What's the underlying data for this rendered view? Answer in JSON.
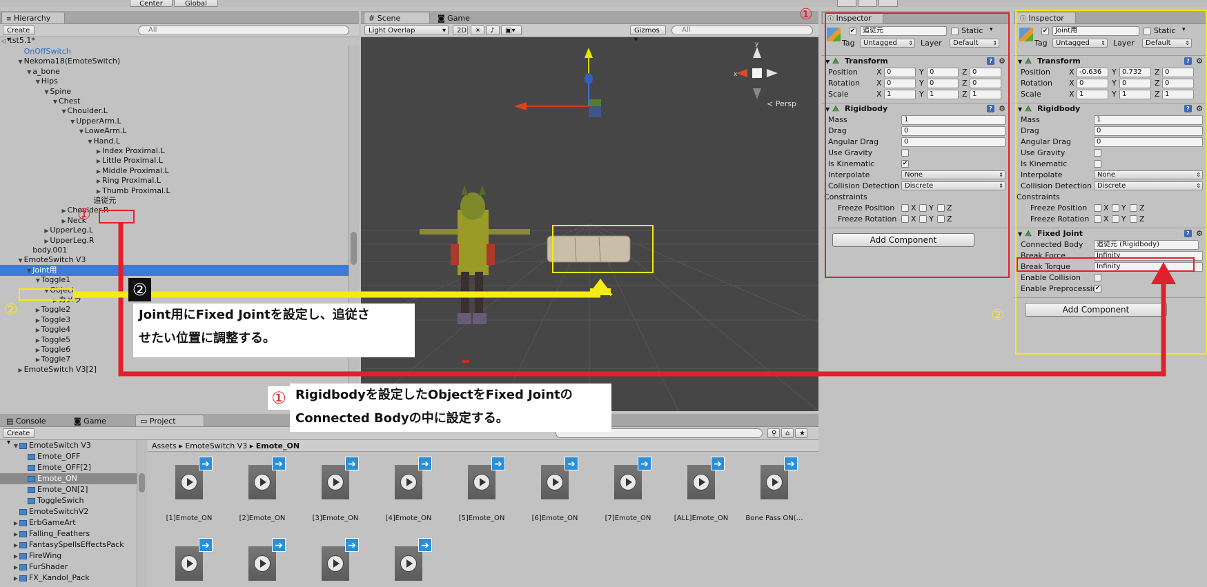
{
  "top_toolbar": {
    "center_label": "Center",
    "global_label": "Global"
  },
  "hierarchy": {
    "tab": "Hierarchy",
    "create_label": "Create",
    "search_placeholder": "All",
    "scene_name": "tst5.1*",
    "items": [
      {
        "label": "OnOffSwitch",
        "depth": 1,
        "arrow": "",
        "blue": true
      },
      {
        "label": "Nekoma18(EmoteSwitch)",
        "depth": 1,
        "arrow": "▼"
      },
      {
        "label": "a_bone",
        "depth": 2,
        "arrow": "▼"
      },
      {
        "label": "Hips",
        "depth": 3,
        "arrow": "▼"
      },
      {
        "label": "Spine",
        "depth": 4,
        "arrow": "▼"
      },
      {
        "label": "Chest",
        "depth": 5,
        "arrow": "▼"
      },
      {
        "label": "Choulder.L",
        "depth": 6,
        "arrow": "▼"
      },
      {
        "label": "UpperArm.L",
        "depth": 7,
        "arrow": "▼"
      },
      {
        "label": "LoweArm.L",
        "depth": 8,
        "arrow": "▼"
      },
      {
        "label": "Hand.L",
        "depth": 9,
        "arrow": "▼"
      },
      {
        "label": "Index Proximal.L",
        "depth": 10,
        "arrow": "▶"
      },
      {
        "label": "Little Proximal.L",
        "depth": 10,
        "arrow": "▶"
      },
      {
        "label": "Middle Proximal.L",
        "depth": 10,
        "arrow": "▶"
      },
      {
        "label": "Ring Proximal.L",
        "depth": 10,
        "arrow": "▶"
      },
      {
        "label": "Thumb Proximal.L",
        "depth": 10,
        "arrow": "▶"
      },
      {
        "label": "追従元",
        "depth": 9,
        "arrow": ""
      },
      {
        "label": "Choulder.R",
        "depth": 6,
        "arrow": "▶"
      },
      {
        "label": "Neck",
        "depth": 6,
        "arrow": "▶"
      },
      {
        "label": "UpperLeg.L",
        "depth": 4,
        "arrow": "▶"
      },
      {
        "label": "UpperLeg.R",
        "depth": 4,
        "arrow": "▶"
      },
      {
        "label": "body.001",
        "depth": 2,
        "arrow": ""
      },
      {
        "label": "EmoteSwitch V3",
        "depth": 1,
        "arrow": "▼"
      },
      {
        "label": "Joint用",
        "depth": 2,
        "arrow": "▼",
        "selected": true
      },
      {
        "label": "Toggle1",
        "depth": 3,
        "arrow": "▼"
      },
      {
        "label": "Object",
        "depth": 4,
        "arrow": "▼"
      },
      {
        "label": "カメラ",
        "depth": 5,
        "arrow": "▶"
      },
      {
        "label": "Toggle2",
        "depth": 3,
        "arrow": "▶"
      },
      {
        "label": "Toggle3",
        "depth": 3,
        "arrow": "▶"
      },
      {
        "label": "Toggle4",
        "depth": 3,
        "arrow": "▶"
      },
      {
        "label": "Toggle5",
        "depth": 3,
        "arrow": "▶"
      },
      {
        "label": "Toggle6",
        "depth": 3,
        "arrow": "▶"
      },
      {
        "label": "Toggle7",
        "depth": 3,
        "arrow": "▶"
      },
      {
        "label": "EmoteSwitch V3[2]",
        "depth": 1,
        "arrow": "▶"
      }
    ]
  },
  "scene": {
    "tab_scene": "Scene",
    "tab_game": "Game",
    "overlay_label": "Light Overlap",
    "mode_2d": "2D",
    "gizmos_label": "Gizmos",
    "search_placeholder": "All",
    "persp_label": "Persp"
  },
  "inspector_left": {
    "tab": "Inspector",
    "object_name": "追従元",
    "static_label": "Static",
    "tag_label": "Tag",
    "tag_value": "Untagged",
    "layer_label": "Layer",
    "layer_value": "Default",
    "transform": {
      "title": "Transform",
      "position": {
        "label": "Position",
        "x": "0",
        "y": "0",
        "z": "0"
      },
      "rotation": {
        "label": "Rotation",
        "x": "0",
        "y": "0",
        "z": "0"
      },
      "scale": {
        "label": "Scale",
        "x": "1",
        "y": "1",
        "z": "1"
      }
    },
    "rigidbody": {
      "title": "Rigidbody",
      "mass": "1",
      "drag": "0",
      "angular_drag": "0",
      "use_gravity": false,
      "is_kinematic": true,
      "interpolate": "None",
      "collision_detection": "Discrete"
    },
    "add_component": "Add Component"
  },
  "inspector_right": {
    "tab": "Inspector",
    "object_name": "Joint用",
    "static_label": "Static",
    "tag_label": "Tag",
    "tag_value": "Untagged",
    "layer_label": "Layer",
    "layer_value": "Default",
    "transform": {
      "title": "Transform",
      "position": {
        "label": "Position",
        "x": "-0.636",
        "y": "0.732",
        "z": "0"
      },
      "rotation": {
        "label": "Rotation",
        "x": "0",
        "y": "0",
        "z": "0"
      },
      "scale": {
        "label": "Scale",
        "x": "1",
        "y": "1",
        "z": "1"
      }
    },
    "rigidbody": {
      "title": "Rigidbody",
      "mass": "1",
      "drag": "0",
      "angular_drag": "0",
      "use_gravity": false,
      "is_kinematic": false,
      "interpolate": "None",
      "collision_detection": "Discrete"
    },
    "fixed_joint": {
      "title": "Fixed Joint",
      "connected_body_label": "Connected Body",
      "connected_body_value": "追従元 (Rigidbody)",
      "break_force_label": "Break Force",
      "break_force": "Infinity",
      "break_torque_label": "Break Torque",
      "break_torque": "Infinity",
      "enable_collision_label": "Enable Collision",
      "enable_preprocessing_label": "Enable Preprocessin"
    },
    "add_component": "Add Component"
  },
  "labels": {
    "mass": "Mass",
    "drag": "Drag",
    "angular_drag": "Angular Drag",
    "use_gravity": "Use Gravity",
    "is_kinematic": "Is Kinematic",
    "interpolate": "Interpolate",
    "collision_detection": "Collision Detection",
    "constraints": "Constraints",
    "freeze_position": "Freeze Position",
    "freeze_rotation": "Freeze Rotation",
    "x": "X",
    "y": "Y",
    "z": "Z"
  },
  "bottom": {
    "tab_console": "Console",
    "tab_game": "Game",
    "tab_project": "Project",
    "create_label": "Create",
    "breadcrumb": [
      "Assets",
      "EmoteSwitch V3",
      "Emote_ON"
    ],
    "tree": [
      {
        "label": "EmoteSwitch V3",
        "depth": 1,
        "arrow": "▼"
      },
      {
        "label": "Emote_OFF",
        "depth": 2,
        "arrow": ""
      },
      {
        "label": "Emote_OFF[2]",
        "depth": 2,
        "arrow": ""
      },
      {
        "label": "Emote_ON",
        "depth": 2,
        "arrow": "",
        "selected": true
      },
      {
        "label": "Emote_ON[2]",
        "depth": 2,
        "arrow": ""
      },
      {
        "label": "ToggleSwich",
        "depth": 2,
        "arrow": ""
      },
      {
        "label": "EmoteSwitchV2",
        "depth": 1,
        "arrow": ""
      },
      {
        "label": "ErbGameArt",
        "depth": 1,
        "arrow": "▶"
      },
      {
        "label": "Falling_Feathers",
        "depth": 1,
        "arrow": "▶"
      },
      {
        "label": "FantasySpellsEffectsPack",
        "depth": 1,
        "arrow": "▶"
      },
      {
        "label": "FireWing",
        "depth": 1,
        "arrow": "▶"
      },
      {
        "label": "FurShader",
        "depth": 1,
        "arrow": "▶"
      },
      {
        "label": "FX_Kandol_Pack",
        "depth": 1,
        "arrow": "▶"
      }
    ],
    "assets": [
      "[1]Emote_ON",
      "[2]Emote_ON",
      "[3]Emote_ON",
      "[4]Emote_ON",
      "[5]Emote_ON",
      "[6]Emote_ON",
      "[7]Emote_ON",
      "[ALL]Emote_ON",
      "Bone Pass ON(…",
      "",
      "",
      "",
      ""
    ]
  },
  "annotations": {
    "step1_text_line1": "Rigidbodyを設定したObjectをFixed Jointの",
    "step1_text_line2": "Connected Bodyの中に設定する。",
    "step2_text_line1": "Joint用にFixed Jointを設定し、追従さ",
    "step2_text_line2": "せたい位置に調整する。",
    "num1": "①",
    "num2": "②",
    "colors": {
      "red": "#e0212b",
      "yellow": "#f4ea14",
      "selection": "#3d7bd8"
    }
  }
}
